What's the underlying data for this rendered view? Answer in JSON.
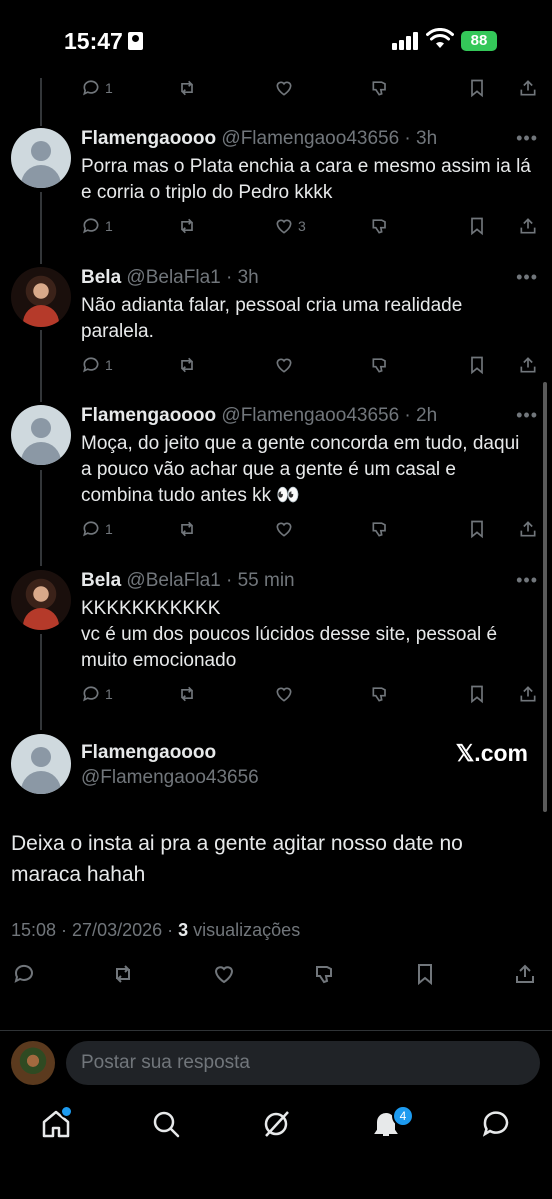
{
  "status_bar": {
    "time": "15:47",
    "battery": "88"
  },
  "replies": [
    {
      "name": "Flamengaoooo",
      "handle": "@Flamengaoo43656",
      "time": "3h",
      "text": "Porra mas o Plata enchia a cara e mesmo assim ia lá e corria o triplo do Pedro kkkk",
      "replies": "1",
      "likes": "3",
      "avatar": "default-avatar"
    },
    {
      "name": "Bela",
      "handle": "@BelaFla1",
      "time": "3h",
      "text": "Não adianta falar, pessoal cria uma realidade paralela.",
      "replies": "1",
      "likes": "",
      "avatar": "photo-avatar"
    },
    {
      "name": "Flamengaoooo",
      "handle": "@Flamengaoo43656",
      "time": "2h",
      "text": "Moça, do jeito que a gente concorda em tudo, daqui a pouco vão achar que a gente é um casal e combina tudo antes kk 👀",
      "replies": "1",
      "likes": "",
      "avatar": "default-avatar"
    },
    {
      "name": "Bela",
      "handle": "@BelaFla1",
      "time": "55 min",
      "text_lines": [
        "KKKKKKKKKKK",
        "vc é um dos poucos lúcidos desse site, pessoal é muito emocionado"
      ],
      "replies": "1",
      "likes": "",
      "avatar": "photo-avatar"
    }
  ],
  "top_actions": {
    "replies": "1"
  },
  "main_tweet": {
    "name": "Flamengaoooo",
    "handle": "@Flamengaoo43656",
    "watermark": "𝕏.com",
    "text": "Deixa o insta ai pra a gente agitar nosso date no maraca hahah",
    "timestamp": "15:08 · 27/03/2026 · ",
    "views_count": "3",
    "views_label": " visualizações"
  },
  "reply_box": {
    "placeholder": "Postar sua resposta"
  },
  "bottom_nav": {
    "items": [
      "home-icon",
      "search-icon",
      "grok-icon",
      "notifications-icon",
      "messages-icon"
    ],
    "notifications_badge": "4"
  },
  "colors": {
    "background": "#000000",
    "text": "#e7e9ea",
    "muted": "#71767b",
    "accent": "#1d9bf0"
  }
}
